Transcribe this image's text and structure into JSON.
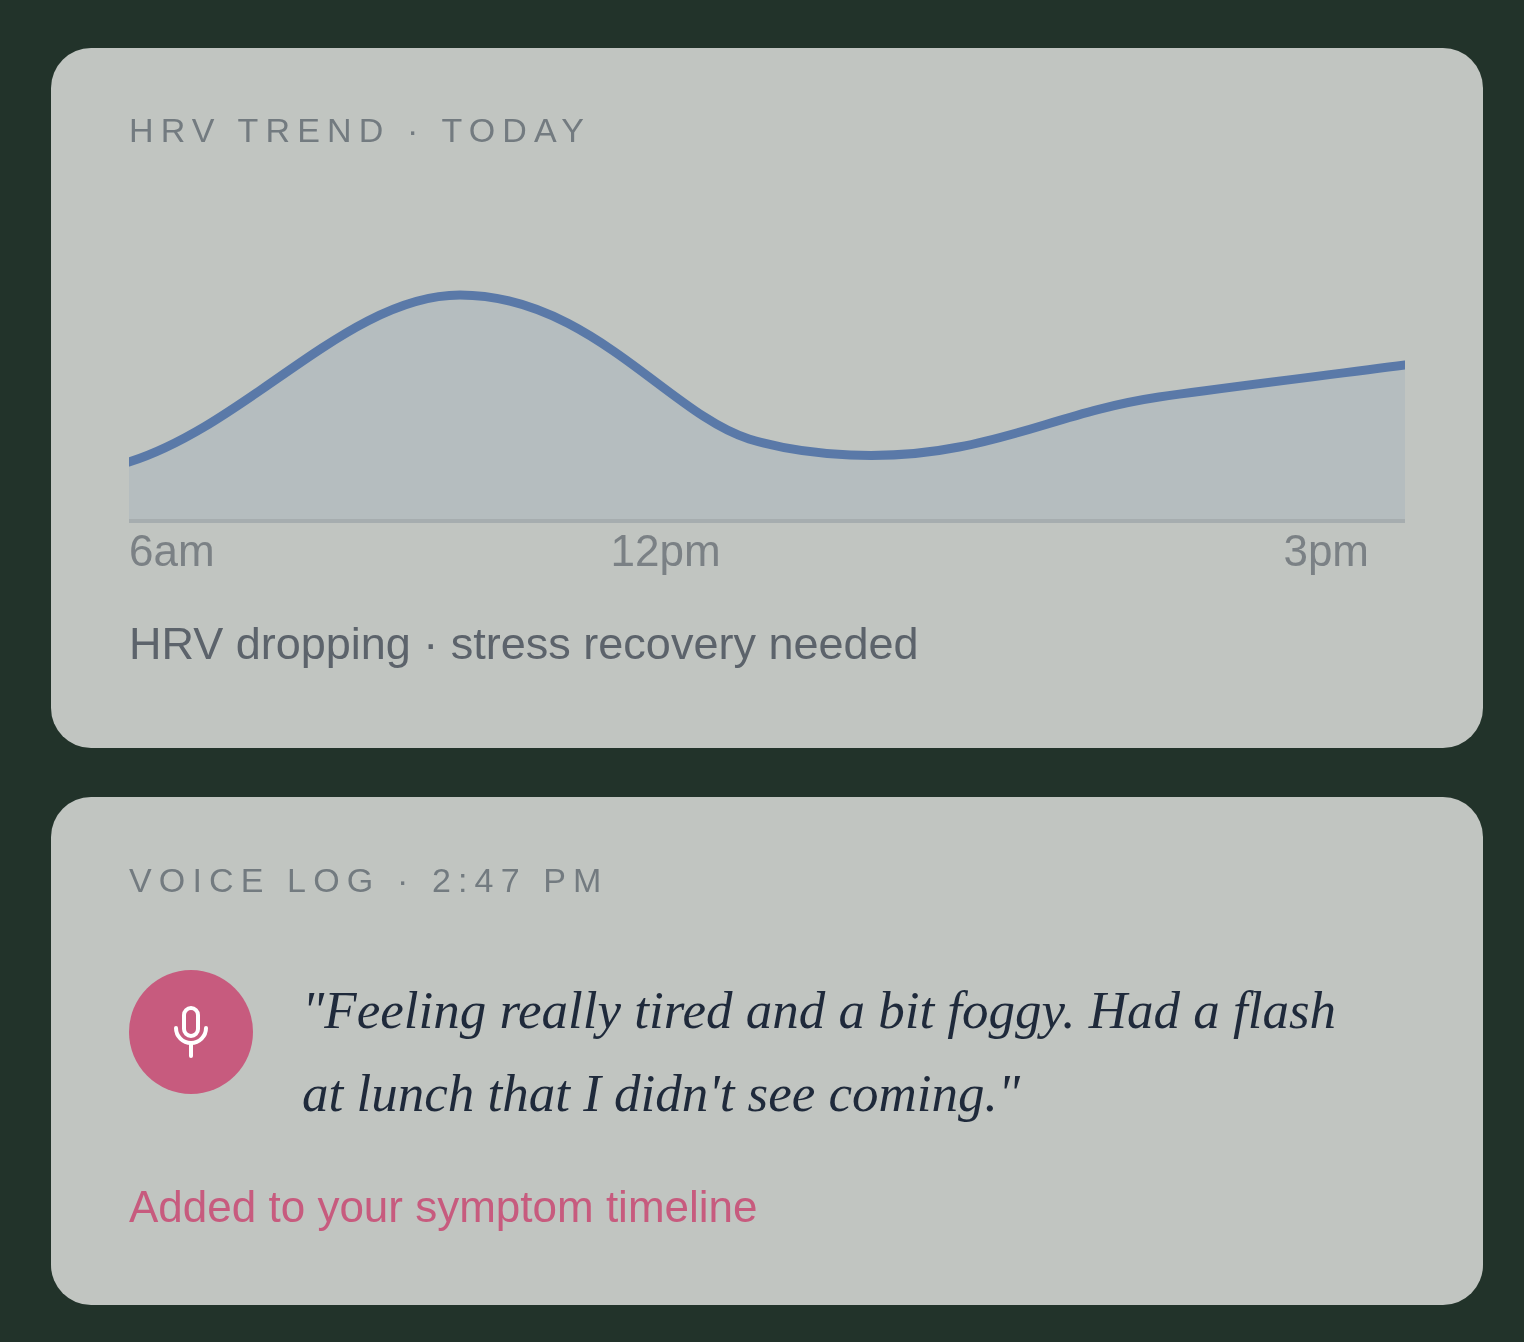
{
  "hrv_card": {
    "title": "HRV TREND · TODAY",
    "x_labels": [
      "6am",
      "12pm",
      "3pm"
    ],
    "summary": "HRV dropping · stress recovery needed"
  },
  "voice_log_card": {
    "title": "VOICE LOG · 2:47 PM",
    "transcript": "\"Feeling really tired and a bit foggy. Had a flash at lunch that I didn't see coming.\"",
    "status": "Added to your symptom timeline"
  }
}
